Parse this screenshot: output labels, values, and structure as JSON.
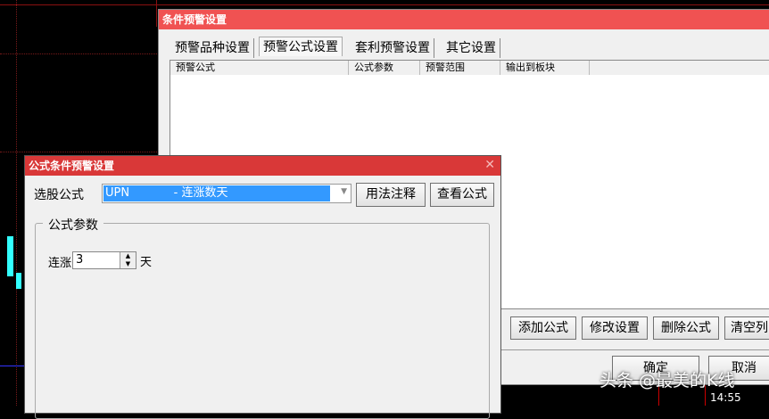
{
  "back_dialog": {
    "title": "条件预警设置",
    "tabs": [
      "预警品种设置",
      "预警公式设置",
      "套利预警设置",
      "其它设置"
    ],
    "active_tab": 1,
    "columns": [
      "预警公式",
      "公式参数",
      "预警范围",
      "输出到板块"
    ],
    "buttons": [
      "添加公式",
      "修改设置",
      "删除公式",
      "清空列"
    ],
    "ok": "确定",
    "cancel": "取消"
  },
  "front_dialog": {
    "title": "公式条件预警设置",
    "formula_label": "选股公式",
    "formula_value": "UPN            - 连涨数天",
    "usage_button": "用法注释",
    "view_button": "查看公式",
    "group_title": "公式参数",
    "param_label": "连涨",
    "param_value": "3",
    "param_unit": "天"
  },
  "chart": {
    "time_label": "14:55"
  },
  "watermark": "头条 @最美的K线",
  "colors": {
    "back_title": "#f05252",
    "front_title": "#d93838",
    "selection": "#3399ff"
  }
}
